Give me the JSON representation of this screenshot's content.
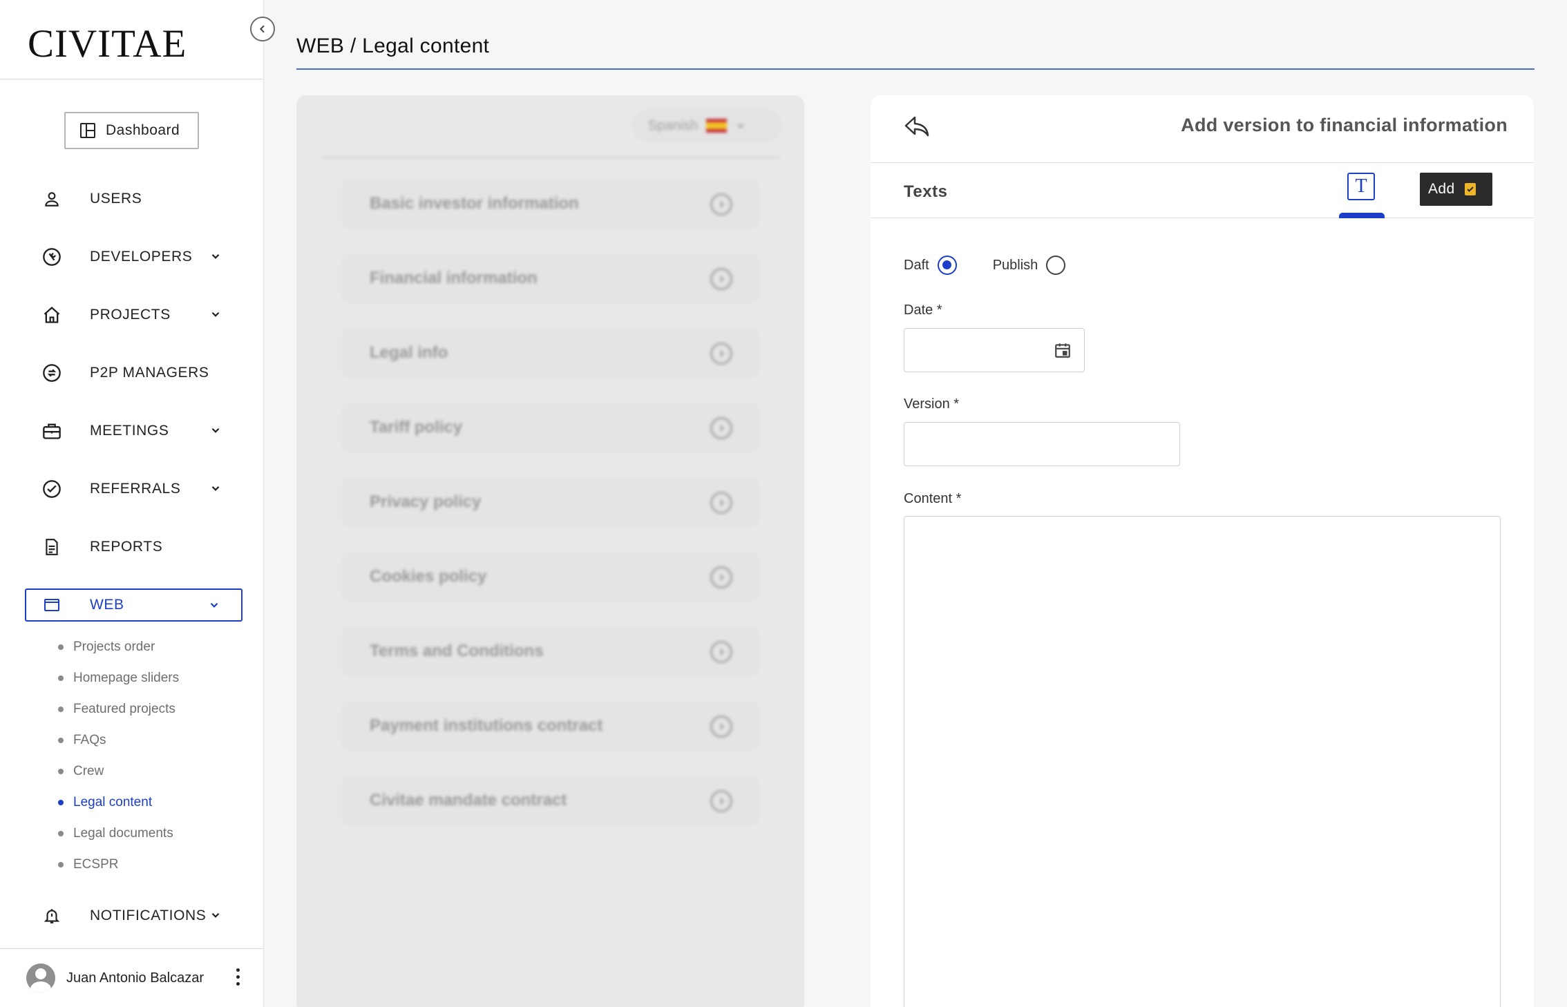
{
  "sidebar": {
    "logo": "CIVITAE",
    "dashboard_label": "Dashboard",
    "items": [
      {
        "label": "USERS",
        "icon": "user-icon"
      },
      {
        "label": "DEVELOPERS",
        "icon": "wrench-circle-icon"
      },
      {
        "label": "PROJECTS",
        "icon": "home-icon"
      },
      {
        "label": "P2P MANAGERS",
        "icon": "exchange-circle-icon"
      },
      {
        "label": "MEETINGS",
        "icon": "briefcase-icon"
      },
      {
        "label": "REFERRALS",
        "icon": "check-circle-icon"
      },
      {
        "label": "REPORTS",
        "icon": "document-icon"
      },
      {
        "label": "WEB",
        "icon": "browser-window-icon"
      },
      {
        "label": "NOTIFICATIONS",
        "icon": "bell-icon"
      }
    ],
    "web_subitems": [
      "Projects order",
      "Homepage sliders",
      "Featured projects",
      "FAQs",
      "Crew",
      "Legal content",
      "Legal documents",
      "ECSPR"
    ],
    "active_subitem": "Legal content",
    "user_name": "Juan Antonio Balcazar"
  },
  "header": {
    "title": "WEB / Legal content"
  },
  "legal_panel": {
    "language": "Spanish",
    "items": [
      "Basic investor information",
      "Financial information",
      "Legal info",
      "Tariff policy",
      "Privacy policy",
      "Cookies policy",
      "Terms and Conditions",
      "Payment institutions contract",
      "Civitae mandate contract"
    ]
  },
  "form": {
    "title": "Add version to financial information",
    "tab_label": "Texts",
    "add_label": "Add",
    "radio_draft": "Daft",
    "radio_publish": "Publish",
    "selected_status": "Daft",
    "date_label": "Date *",
    "date_value": "",
    "version_label": "Version *",
    "version_value": "",
    "content_label": "Content *",
    "content_value": ""
  },
  "colors": {
    "accent": "#1c3ec9",
    "dark_button": "#2a2a2a",
    "checkbox_yellow": "#f0b429"
  }
}
